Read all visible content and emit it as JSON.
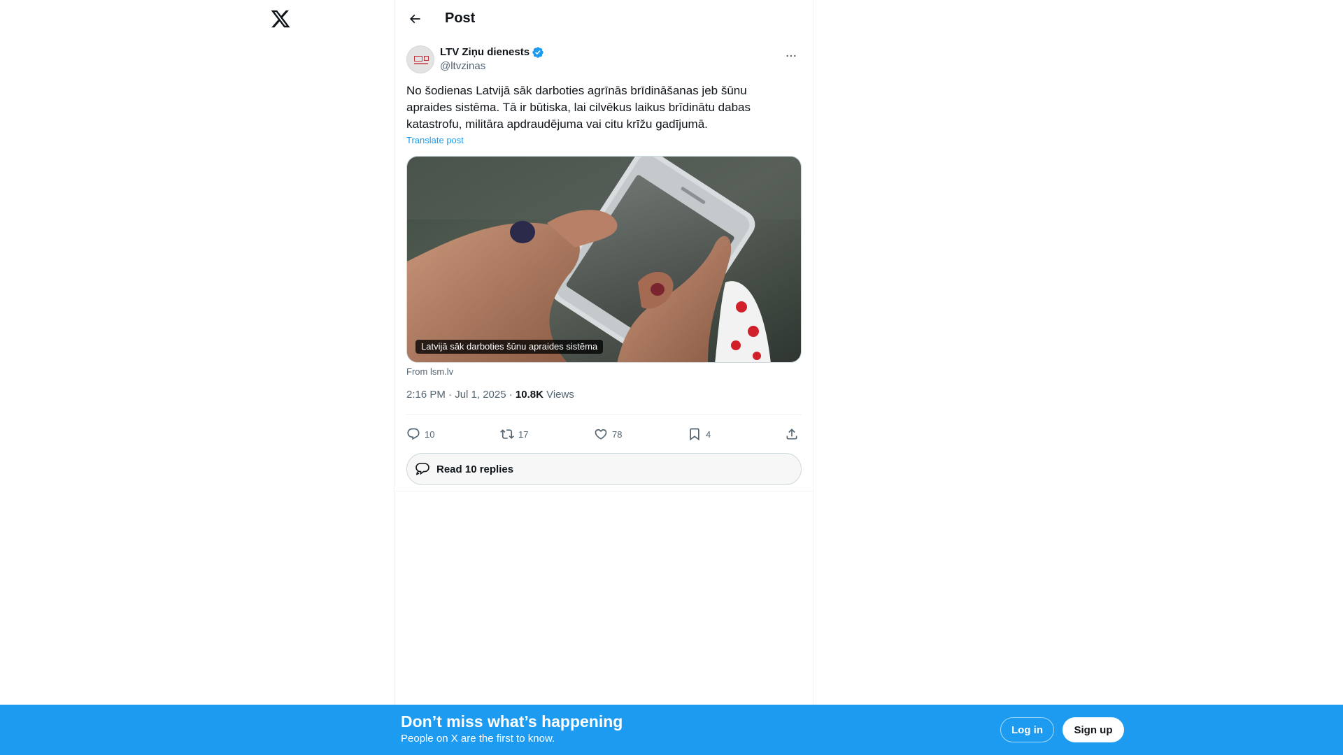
{
  "app": {
    "logo_icon": "x-logo-icon"
  },
  "header": {
    "title": "Post",
    "back_icon": "arrow-left-icon"
  },
  "post": {
    "author_name": "LTV Ziņu dienests",
    "author_handle": "@ltvzinas",
    "verified": true,
    "text": "No šodienas Latvijā sāk darboties agrīnās brīdināšanas jeb šūnu\napraides sistēma. Tā ir būtiska, lai cilvēkus laikus brīdinātu dabas\nkatastrofu, militāra apdraudējuma vai citu krīžu gadījumā.",
    "translate_label": "Translate post",
    "card": {
      "caption": "Latvijā sāk darboties šūnu apraides sistēma",
      "source": "From lsm.lv"
    },
    "timestamp": "2:16 PM · Jul 1, 2025 · ",
    "views_count": "10.8K",
    "views_label": " Views",
    "actions": {
      "replies": "10",
      "reposts": "17",
      "likes": "78",
      "bookmarks": "4"
    },
    "read_replies_label": "Read 10 replies"
  },
  "banner": {
    "title": "Don’t miss what’s happening",
    "subtitle": "People on X are the first to know.",
    "login_label": "Log in",
    "signup_label": "Sign up"
  },
  "colors": {
    "accent": "#1d9bf0",
    "text": "#0f1419",
    "secondary": "#536471",
    "border": "#eff3f4"
  }
}
